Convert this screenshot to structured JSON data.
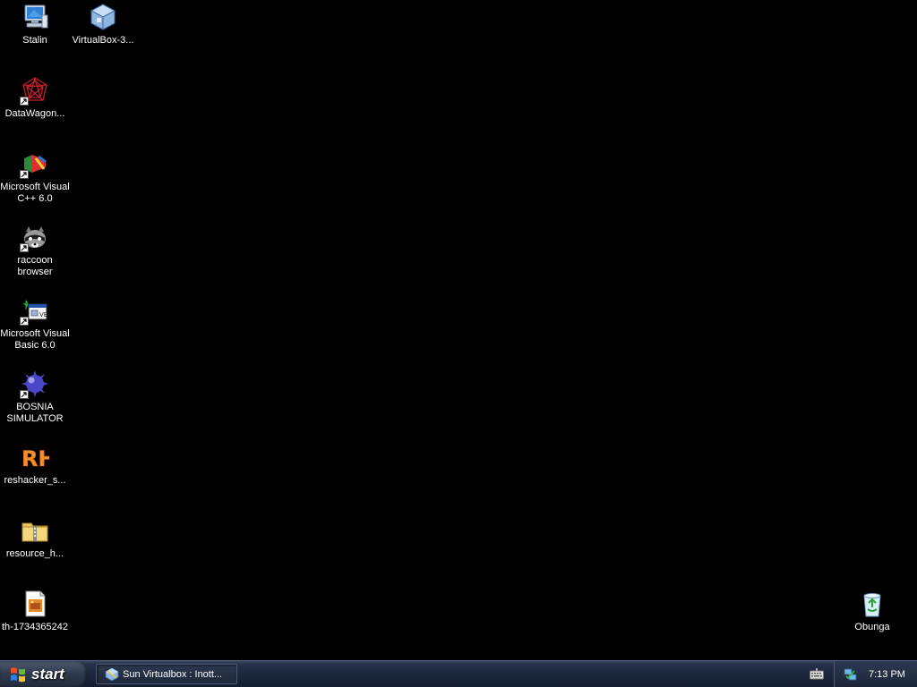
{
  "desktop": {
    "background_color": "#000000",
    "icons": [
      {
        "label": "Stalin",
        "icon": "my-computer-icon"
      },
      {
        "label": "VirtualBox-3...",
        "icon": "virtualbox-icon"
      },
      {
        "label": "DataWagon...",
        "icon": "datawagon-icon"
      },
      {
        "label": "Microsoft Visual\nC++ 6.0",
        "icon": "visual-cpp-icon"
      },
      {
        "label": "raccoon\nbrowser",
        "icon": "raccoon-icon"
      },
      {
        "label": "Microsoft Visual\nBasic 6.0",
        "icon": "visual-basic-icon"
      },
      {
        "label": "BOSNIA\nSIMULATOR",
        "icon": "bosnia-simulator-icon"
      },
      {
        "label": "reshacker_s...",
        "icon": "reshacker-icon"
      },
      {
        "label": "resource_h...",
        "icon": "zip-folder-icon"
      },
      {
        "label": "th-1734365242",
        "icon": "image-file-icon"
      },
      {
        "label": "Obunga",
        "icon": "recycle-bin-icon"
      }
    ]
  },
  "taskbar": {
    "start_label": "start",
    "tasks": [
      {
        "label": "Sun Virtualbox : Inott...",
        "icon": "virtualbox-icon"
      }
    ],
    "tray": {
      "keyboard_icon": "keyboard-icon",
      "network_icon": "network-icon",
      "clock": "7:13 PM"
    }
  }
}
